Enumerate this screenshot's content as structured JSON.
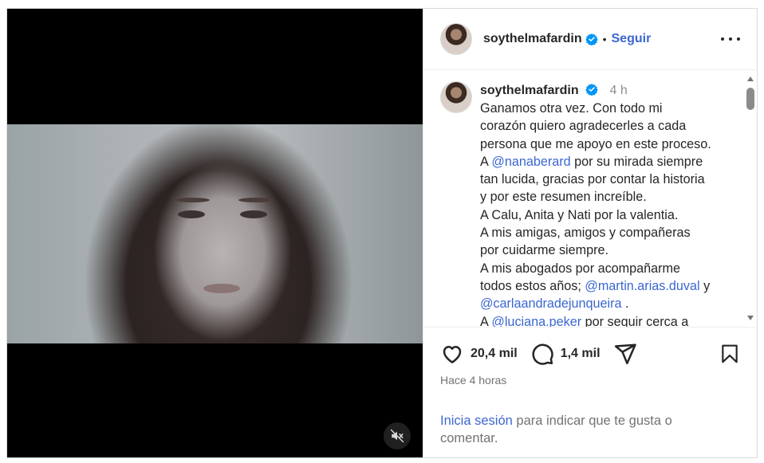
{
  "post": {
    "author": {
      "username": "soythelmafardin",
      "verified": true,
      "follow_label": "Seguir",
      "separator": "•"
    },
    "media": {
      "type": "video",
      "muted": true
    },
    "caption": {
      "time_ago": "4 h",
      "lines": [
        {
          "parts": [
            {
              "text": "Ganamos otra vez. Con todo mi"
            }
          ]
        },
        {
          "parts": [
            {
              "text": "corazón quiero agradecerles a cada"
            }
          ]
        },
        {
          "parts": [
            {
              "text": "persona que me apoyo en este proceso."
            }
          ]
        },
        {
          "parts": [
            {
              "text": "A "
            },
            {
              "text": "@nanaberard",
              "mention": true
            },
            {
              "text": " por su mirada siempre"
            }
          ]
        },
        {
          "parts": [
            {
              "text": "tan lucida, gracias por contar la historia"
            }
          ]
        },
        {
          "parts": [
            {
              "text": "y por este resumen increíble."
            }
          ]
        },
        {
          "parts": [
            {
              "text": "A Calu, Anita y Nati por la valentia."
            }
          ]
        },
        {
          "parts": [
            {
              "text": "A mis amigas, amigos y compañeras"
            }
          ]
        },
        {
          "parts": [
            {
              "text": "por cuidarme siempre."
            }
          ]
        },
        {
          "parts": [
            {
              "text": "A mis abogados por acompañarme"
            }
          ]
        },
        {
          "parts": [
            {
              "text": "todos estos años; "
            },
            {
              "text": "@martin.arias.duval",
              "mention": true
            },
            {
              "text": " y"
            }
          ]
        },
        {
          "parts": [
            {
              "text": "@carlaandradejunqueira",
              "mention": true
            },
            {
              "text": " ."
            }
          ]
        },
        {
          "parts": [
            {
              "text": "A "
            },
            {
              "text": "@luciana.peker",
              "mention": true
            },
            {
              "text": " por seguir cerca a"
            }
          ]
        }
      ]
    },
    "stats": {
      "likes": "20,4 mil",
      "comments": "1,4 mil"
    },
    "posted_ago": "Hace 4 horas",
    "login_prompt": {
      "link": "Inicia sesión",
      "rest": " para indicar que te gusta o comentar."
    }
  },
  "colors": {
    "link": "#3b67d1",
    "muted_text": "#737373",
    "verified_badge": "#0095f6"
  },
  "icons": {
    "more": "more-horizontal-icon",
    "like": "heart-outline-icon",
    "comment": "speech-bubble-icon",
    "share": "paper-plane-icon",
    "save": "bookmark-outline-icon",
    "mute": "speaker-muted-icon",
    "verified": "verified-badge-icon"
  }
}
